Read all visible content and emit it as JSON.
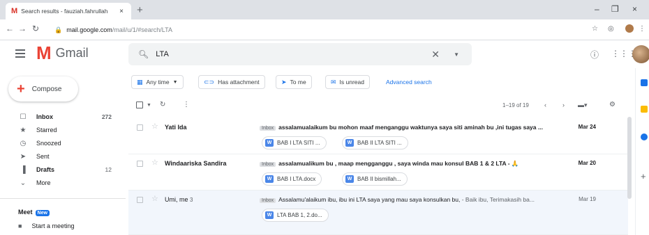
{
  "browser": {
    "tab_title": "Search results - fauziah.fahrullah",
    "tab_icon": "M",
    "tab_close": "×",
    "new_tab": "+",
    "url_host": "mail.google.com",
    "url_path": "/mail/u/1/#search/LTA",
    "win_min": "–",
    "win_max": "❐",
    "win_close": "×"
  },
  "gmail": {
    "app_name": "Gmail",
    "search_value": "LTA",
    "compose_label": "Compose"
  },
  "sidebar": {
    "items": [
      {
        "label": "Inbox",
        "count": "272",
        "icon": "inbox-icon",
        "glyph": "☐"
      },
      {
        "label": "Starred",
        "count": "",
        "icon": "star-icon",
        "glyph": "★"
      },
      {
        "label": "Snoozed",
        "count": "",
        "icon": "clock-icon",
        "glyph": "◷"
      },
      {
        "label": "Sent",
        "count": "",
        "icon": "send-icon",
        "glyph": "➤"
      },
      {
        "label": "Drafts",
        "count": "12",
        "icon": "draft-icon",
        "glyph": "▐"
      },
      {
        "label": "More",
        "count": "",
        "icon": "chevron-down-icon",
        "glyph": "⌄"
      }
    ],
    "meet_title": "Meet",
    "meet_badge": "New",
    "start_meeting": "Start a meeting"
  },
  "filters": {
    "any_time": "Any time",
    "has_attachment": "Has attachment",
    "to_me": "To me",
    "is_unread": "Is unread",
    "advanced": "Advanced search"
  },
  "toolbar": {
    "pager": "1–19 of 19"
  },
  "emails": [
    {
      "sender": "Yati Ida",
      "count": "",
      "label": "Inbox",
      "subject": "assalamualaikum bu mohon maaf menganggu waktunya saya siti aminah bu ,ini tugas saya ...",
      "snippet": "",
      "date": "Mar 24",
      "read": false,
      "attachments": [
        "BAB I LTA SITI ...",
        "BAB II LTA SITI ..."
      ]
    },
    {
      "sender": "Windaariska Sandira",
      "count": "",
      "label": "Inbox",
      "subject": "assalamualikum bu , maap mengganggu , saya winda mau konsul BAB 1 & 2 LTA - 🙏",
      "snippet": "",
      "date": "Mar 20",
      "read": false,
      "attachments": [
        "BAB I LTA.docx",
        "BAB II bismillah..."
      ]
    },
    {
      "sender": "Umi, me",
      "count": "3",
      "label": "Inbox",
      "subject": "Assalamu'alaikum ibu, ibu ini LTA saya yang mau saya konsulkan bu,",
      "snippet": " - Baik ibu, Terimakasih ba...",
      "date": "Mar 19",
      "read": true,
      "attachments": [
        "LTA BAB 1, 2.do..."
      ]
    }
  ],
  "colors": {
    "accent": "#1a73e8",
    "gmail_red": "#ea4335"
  }
}
